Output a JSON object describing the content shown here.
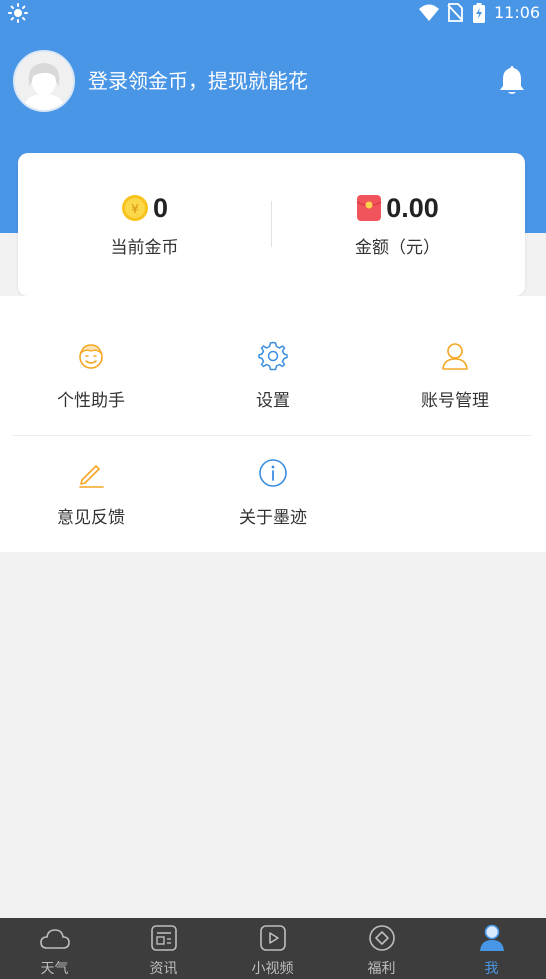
{
  "status_bar": {
    "time": "11:06"
  },
  "profile": {
    "login_prompt": "登录领金币，提现就能花"
  },
  "wallet": {
    "coins": {
      "value": "0",
      "label": "当前金币"
    },
    "amount": {
      "value": "0.00",
      "label": "金额（元）"
    }
  },
  "menu": {
    "items": [
      {
        "label": "个性助手"
      },
      {
        "label": "设置"
      },
      {
        "label": "账号管理"
      },
      {
        "label": "意见反馈"
      },
      {
        "label": "关于墨迹"
      }
    ]
  },
  "tabs": [
    {
      "label": "天气"
    },
    {
      "label": "资讯"
    },
    {
      "label": "小视频"
    },
    {
      "label": "福利"
    },
    {
      "label": "我"
    }
  ],
  "colors": {
    "accent": "#4a96e6",
    "orange_icon": "#f5a623",
    "tabbar_bg": "#3d3d3d"
  }
}
